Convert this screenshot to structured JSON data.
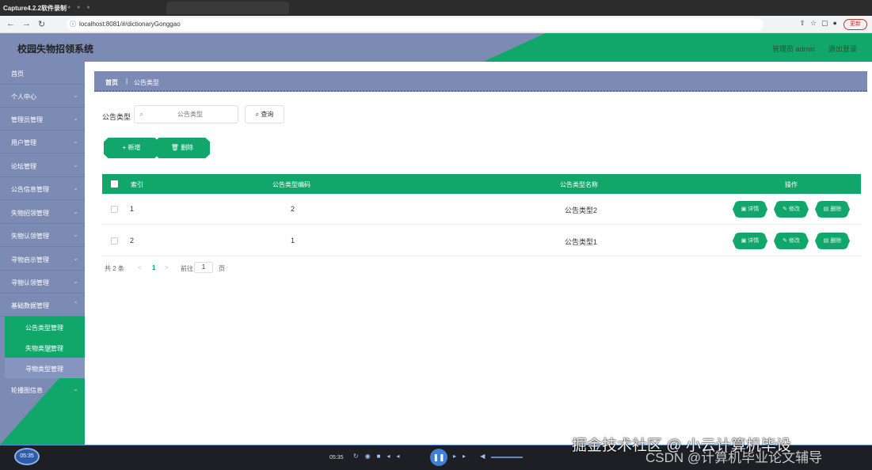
{
  "capture": {
    "title": "Capture4.2.2软件录制"
  },
  "browser": {
    "url": "localhost:8081/#/dictionaryGonggao",
    "update_label": "更新"
  },
  "header": {
    "app_title": "校园失物招领系统",
    "admin_label": "管理员 admin",
    "logout_label": "退出登录"
  },
  "sidebar": {
    "items": [
      {
        "label": "首页"
      },
      {
        "label": "个人中心"
      },
      {
        "label": "管理员管理"
      },
      {
        "label": "用户管理"
      },
      {
        "label": "论坛管理"
      },
      {
        "label": "公告信息管理"
      },
      {
        "label": "失物招领管理"
      },
      {
        "label": "失物认领管理"
      },
      {
        "label": "寻物启示管理"
      },
      {
        "label": "寻物认领管理"
      },
      {
        "label": "基础数据管理"
      }
    ],
    "sub_items": [
      {
        "label": "公告类型管理"
      },
      {
        "label": "失物类型管理"
      },
      {
        "label": "寻物类型管理"
      }
    ],
    "last_item": {
      "label": "轮播图信息"
    }
  },
  "breadcrumb": {
    "home": "首页",
    "separator": "|",
    "current": "公告类型"
  },
  "search": {
    "label": "公告类型",
    "placeholder": "公告类型",
    "button": "查询"
  },
  "actions": {
    "add": "新增",
    "delete": "删除"
  },
  "table": {
    "headers": {
      "index": "索引",
      "code": "公告类型编码",
      "name": "公告类型名称",
      "ops": "操作"
    },
    "rows": [
      {
        "index": "1",
        "code": "2",
        "name": "公告类型2"
      },
      {
        "index": "2",
        "code": "1",
        "name": "公告类型1"
      }
    ],
    "row_ops": {
      "detail": "详情",
      "edit": "修改",
      "delete": "删除"
    }
  },
  "pager": {
    "total": "共 2 条",
    "prev": "<",
    "page": "1",
    "next": ">",
    "goto": "前往",
    "goto_value": "1",
    "page_unit": "页"
  },
  "player": {
    "orb_time": "05:35",
    "time": "05:35",
    "label": "CSDN @计算机毕业论文辅导"
  },
  "watermark": "掘金技术社区 @ 小云计算机毕设"
}
